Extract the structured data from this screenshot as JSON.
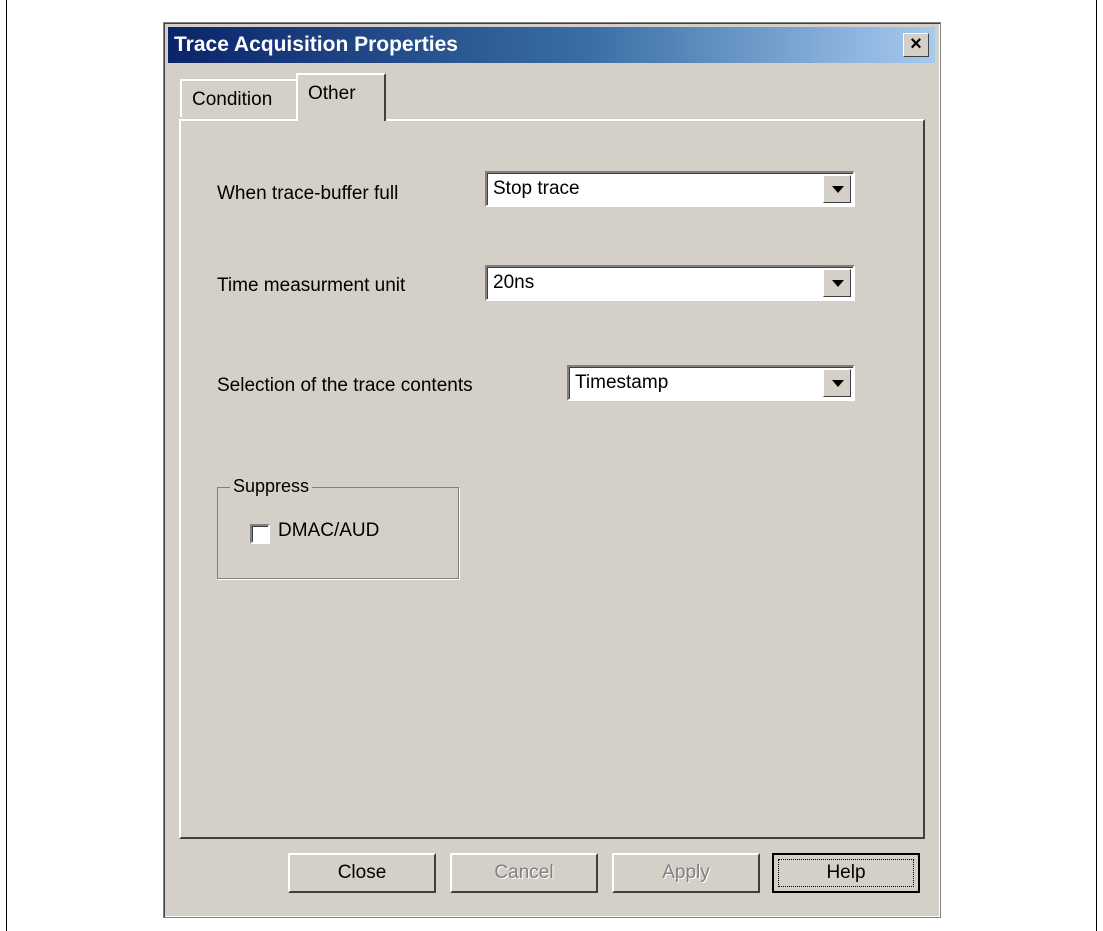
{
  "window": {
    "title": "Trace Acquisition Properties",
    "close_glyph": "×"
  },
  "tabs": [
    {
      "label": "Condition",
      "selected": false
    },
    {
      "label": "Other",
      "selected": true
    }
  ],
  "fields": {
    "buffer_full": {
      "label": "When trace-buffer full",
      "value": "Stop trace"
    },
    "time_unit": {
      "label": "Time measurment unit",
      "value": "20ns"
    },
    "trace_contents": {
      "label": "Selection of the trace contents",
      "value": "Timestamp"
    }
  },
  "suppress": {
    "title": "Suppress",
    "dmac_aud": {
      "label": "DMAC/AUD",
      "checked": false
    }
  },
  "buttons": {
    "close": "Close",
    "cancel": "Cancel",
    "apply": "Apply",
    "help": "Help"
  }
}
